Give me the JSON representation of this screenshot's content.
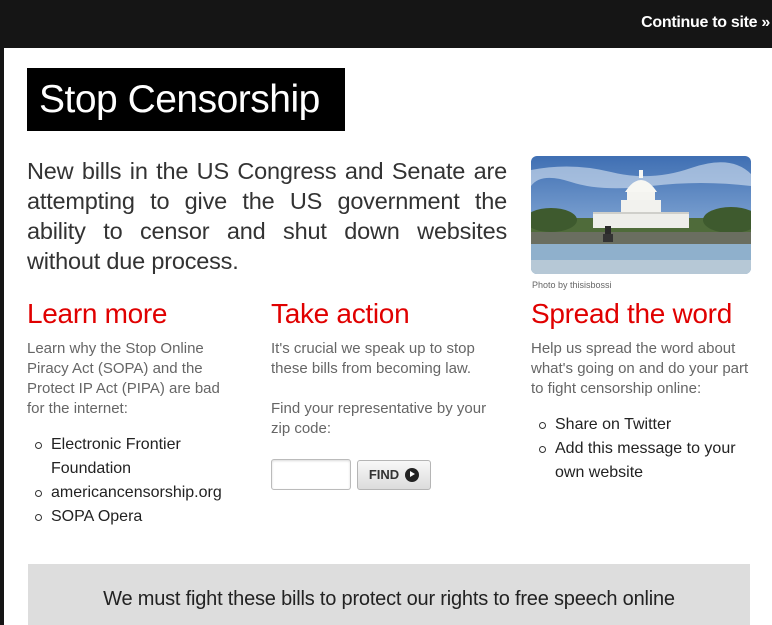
{
  "topbar": {
    "continue_label": "Continue to site »"
  },
  "title": "Stop Censorship",
  "intro": "New bills in the US Congress and Senate are attempting to give the US government the ability to censor and shut down websites without due process.",
  "photo": {
    "credit": "Photo by thisisbossi",
    "icon": "capitol-building-photo"
  },
  "learn_more": {
    "heading": "Learn more",
    "text": "Learn why the Stop Online Piracy Act (SOPA) and the Protect IP Act (PIPA) are bad for the internet:",
    "links": [
      "Electronic Frontier Foundation",
      "americancensorship.org",
      "SOPA Opera"
    ]
  },
  "take_action": {
    "heading": "Take action",
    "text": "It's crucial we speak up to stop these bills from becoming law.",
    "find_text": "Find your representative by your zip code:",
    "zip_value": "",
    "zip_placeholder": "",
    "find_label": "FIND",
    "find_icon": "play-circle-icon"
  },
  "spread_word": {
    "heading": "Spread the word",
    "text": "Help us spread the word about what's going on and do your part to fight censorship online:",
    "links": [
      "Share on Twitter",
      "Add this message to your own website"
    ]
  },
  "footer": {
    "message": "We must fight these bills to protect our rights to free speech online"
  },
  "colors": {
    "heading_red": "#e00000",
    "title_bg": "#000000",
    "topbar_bg": "#151515",
    "footer_bg": "#dddddd"
  }
}
